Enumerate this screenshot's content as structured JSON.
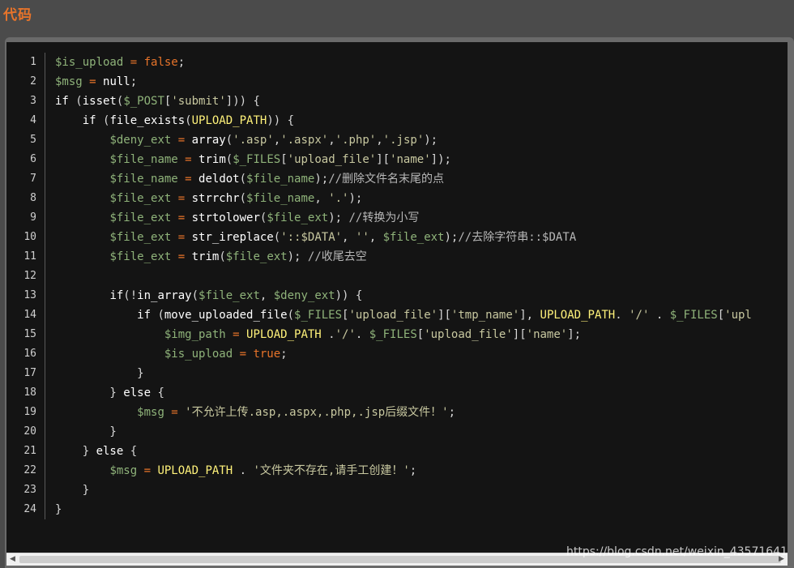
{
  "header": {
    "title": "代码"
  },
  "code": {
    "line_numbers": [
      "1",
      "2",
      "3",
      "4",
      "5",
      "6",
      "7",
      "8",
      "9",
      "10",
      "11",
      "12",
      "13",
      "14",
      "15",
      "16",
      "17",
      "18",
      "19",
      "20",
      "21",
      "22",
      "23",
      "24"
    ],
    "lines": [
      [
        [
          "v",
          "$is_upload"
        ],
        [
          "o",
          " = "
        ],
        [
          "b",
          "false"
        ],
        [
          "n",
          ";"
        ]
      ],
      [
        [
          "v",
          "$msg"
        ],
        [
          "o",
          " = "
        ],
        [
          "k",
          "null"
        ],
        [
          "n",
          ";"
        ]
      ],
      [
        [
          "k",
          "if"
        ],
        [
          "n",
          " ("
        ],
        [
          "k",
          "isset"
        ],
        [
          "n",
          "("
        ],
        [
          "v",
          "$_POST"
        ],
        [
          "n",
          "["
        ],
        [
          "s",
          "'submit'"
        ],
        [
          "n",
          "])) {"
        ]
      ],
      [
        [
          "n",
          "    "
        ],
        [
          "k",
          "if"
        ],
        [
          "n",
          " ("
        ],
        [
          "k",
          "file_exists"
        ],
        [
          "n",
          "("
        ],
        [
          "u",
          "UPLOAD_PATH"
        ],
        [
          "n",
          ")) {"
        ]
      ],
      [
        [
          "n",
          "        "
        ],
        [
          "v",
          "$deny_ext"
        ],
        [
          "o",
          " = "
        ],
        [
          "k",
          "array"
        ],
        [
          "n",
          "("
        ],
        [
          "s",
          "'.asp'"
        ],
        [
          "n",
          ","
        ],
        [
          "s",
          "'.aspx'"
        ],
        [
          "n",
          ","
        ],
        [
          "s",
          "'.php'"
        ],
        [
          "n",
          ","
        ],
        [
          "s",
          "'.jsp'"
        ],
        [
          "n",
          ");"
        ]
      ],
      [
        [
          "n",
          "        "
        ],
        [
          "v",
          "$file_name"
        ],
        [
          "o",
          " = "
        ],
        [
          "k",
          "trim"
        ],
        [
          "n",
          "("
        ],
        [
          "v",
          "$_FILES"
        ],
        [
          "n",
          "["
        ],
        [
          "s",
          "'upload_file'"
        ],
        [
          "n",
          "]["
        ],
        [
          "s",
          "'name'"
        ],
        [
          "n",
          "]);"
        ]
      ],
      [
        [
          "n",
          "        "
        ],
        [
          "v",
          "$file_name"
        ],
        [
          "o",
          " = "
        ],
        [
          "k",
          "deldot"
        ],
        [
          "n",
          "("
        ],
        [
          "v",
          "$file_name"
        ],
        [
          "n",
          ");"
        ],
        [
          "c",
          "//删除文件名末尾的点"
        ]
      ],
      [
        [
          "n",
          "        "
        ],
        [
          "v",
          "$file_ext"
        ],
        [
          "o",
          " = "
        ],
        [
          "k",
          "strrchr"
        ],
        [
          "n",
          "("
        ],
        [
          "v",
          "$file_name"
        ],
        [
          "n",
          ", "
        ],
        [
          "s",
          "'.'"
        ],
        [
          "n",
          ");"
        ]
      ],
      [
        [
          "n",
          "        "
        ],
        [
          "v",
          "$file_ext"
        ],
        [
          "o",
          " = "
        ],
        [
          "k",
          "strtolower"
        ],
        [
          "n",
          "("
        ],
        [
          "v",
          "$file_ext"
        ],
        [
          "n",
          "); "
        ],
        [
          "c",
          "//转换为小写"
        ]
      ],
      [
        [
          "n",
          "        "
        ],
        [
          "v",
          "$file_ext"
        ],
        [
          "o",
          " = "
        ],
        [
          "k",
          "str_ireplace"
        ],
        [
          "n",
          "("
        ],
        [
          "s",
          "'::$DATA'"
        ],
        [
          "n",
          ", "
        ],
        [
          "s",
          "''"
        ],
        [
          "n",
          ", "
        ],
        [
          "v",
          "$file_ext"
        ],
        [
          "n",
          ");"
        ],
        [
          "c",
          "//去除字符串::$DATA"
        ]
      ],
      [
        [
          "n",
          "        "
        ],
        [
          "v",
          "$file_ext"
        ],
        [
          "o",
          " = "
        ],
        [
          "k",
          "trim"
        ],
        [
          "n",
          "("
        ],
        [
          "v",
          "$file_ext"
        ],
        [
          "n",
          "); "
        ],
        [
          "c",
          "//收尾去空"
        ]
      ],
      [],
      [
        [
          "n",
          "        "
        ],
        [
          "k",
          "if"
        ],
        [
          "n",
          "(!"
        ],
        [
          "k",
          "in_array"
        ],
        [
          "n",
          "("
        ],
        [
          "v",
          "$file_ext"
        ],
        [
          "n",
          ", "
        ],
        [
          "v",
          "$deny_ext"
        ],
        [
          "n",
          ")) {"
        ]
      ],
      [
        [
          "n",
          "            "
        ],
        [
          "k",
          "if"
        ],
        [
          "n",
          " ("
        ],
        [
          "k",
          "move_uploaded_file"
        ],
        [
          "n",
          "("
        ],
        [
          "v",
          "$_FILES"
        ],
        [
          "n",
          "["
        ],
        [
          "s",
          "'upload_file'"
        ],
        [
          "n",
          "]["
        ],
        [
          "s",
          "'tmp_name'"
        ],
        [
          "n",
          "], "
        ],
        [
          "u",
          "UPLOAD_PATH"
        ],
        [
          "n",
          ". "
        ],
        [
          "s",
          "'/'"
        ],
        [
          "n",
          " . "
        ],
        [
          "v",
          "$_FILES"
        ],
        [
          "n",
          "["
        ],
        [
          "s",
          "'upl"
        ]
      ],
      [
        [
          "n",
          "                "
        ],
        [
          "v",
          "$img_path"
        ],
        [
          "o",
          " = "
        ],
        [
          "u",
          "UPLOAD_PATH"
        ],
        [
          "n",
          " ."
        ],
        [
          "s",
          "'/'"
        ],
        [
          "n",
          ". "
        ],
        [
          "v",
          "$_FILES"
        ],
        [
          "n",
          "["
        ],
        [
          "s",
          "'upload_file'"
        ],
        [
          "n",
          "]["
        ],
        [
          "s",
          "'name'"
        ],
        [
          "n",
          "];"
        ]
      ],
      [
        [
          "n",
          "                "
        ],
        [
          "v",
          "$is_upload"
        ],
        [
          "o",
          " = "
        ],
        [
          "b",
          "true"
        ],
        [
          "n",
          ";"
        ]
      ],
      [
        [
          "n",
          "            }"
        ]
      ],
      [
        [
          "n",
          "        } "
        ],
        [
          "k",
          "else"
        ],
        [
          "n",
          " {"
        ]
      ],
      [
        [
          "n",
          "            "
        ],
        [
          "v",
          "$msg"
        ],
        [
          "o",
          " = "
        ],
        [
          "s",
          "'不允许上传.asp,.aspx,.php,.jsp后缀文件！'"
        ],
        [
          "n",
          ";"
        ]
      ],
      [
        [
          "n",
          "        }"
        ]
      ],
      [
        [
          "n",
          "    } "
        ],
        [
          "k",
          "else"
        ],
        [
          "n",
          " {"
        ]
      ],
      [
        [
          "n",
          "        "
        ],
        [
          "v",
          "$msg"
        ],
        [
          "o",
          " = "
        ],
        [
          "u",
          "UPLOAD_PATH"
        ],
        [
          "n",
          " . "
        ],
        [
          "s",
          "'文件夹不存在,请手工创建！'"
        ],
        [
          "n",
          ";"
        ]
      ],
      [
        [
          "n",
          "    }"
        ]
      ],
      [
        [
          "n",
          "}"
        ]
      ]
    ]
  },
  "scrollbar": {
    "left_arrow": "◀",
    "right_arrow": "▶"
  },
  "watermark": "https://blog.csdn.net/weixin_43571641"
}
